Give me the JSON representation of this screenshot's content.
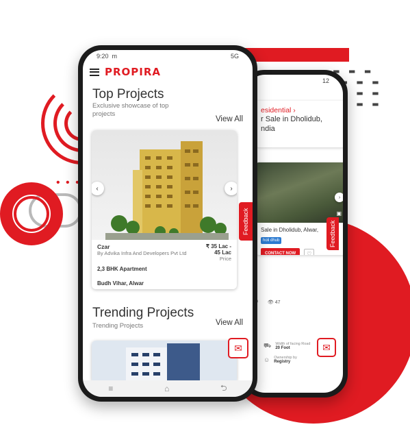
{
  "colors": {
    "brand": "#e01b22",
    "badge_blue": "#2c7bd1"
  },
  "front_phone": {
    "status": {
      "time": "9:20",
      "carrier": "m",
      "right": "5G"
    },
    "header": {
      "menu_icon": "hamburger-icon",
      "logo": "PROPIRA"
    },
    "top_projects": {
      "title": "Top Projects",
      "subtitle": "Exclusive showcase of top projects",
      "view_all": "View All",
      "card": {
        "name": "Czar",
        "developer": "By Advika Infra And Developers Pvt Ltd",
        "price": "₹ 35 Lac - 45 Lac",
        "price_label": "Price",
        "type": "2,3 BHK Apartment",
        "location": "Budh Vihar, Alwar"
      },
      "prev_icon": "chevron-left-icon",
      "next_icon": "chevron-right-icon"
    },
    "feedback": "Feedback",
    "trending": {
      "title": "Trending Projects",
      "subtitle": "Trending Projects",
      "view_all": "View All"
    },
    "nav": {
      "menu": "≡",
      "home": "⌂",
      "back": "⮌"
    }
  },
  "back_phone": {
    "status": {
      "right": "12"
    },
    "breadcrumb": "esidential",
    "title_line1": "r Sale in Dholidub,",
    "title_line2": "ndia",
    "feedback": "Feedback",
    "listing_title": "Sale in Dholidub, Alwar,",
    "badge": "holi dhub",
    "contact_now": "CONTACT NOW",
    "stats": {
      "left": "0",
      "views": "47"
    },
    "specs": {
      "width_label": "Width of facing Road",
      "width_value": "20 Foot",
      "ownership_label": "Ownership by",
      "ownership_value": "Registry"
    }
  }
}
